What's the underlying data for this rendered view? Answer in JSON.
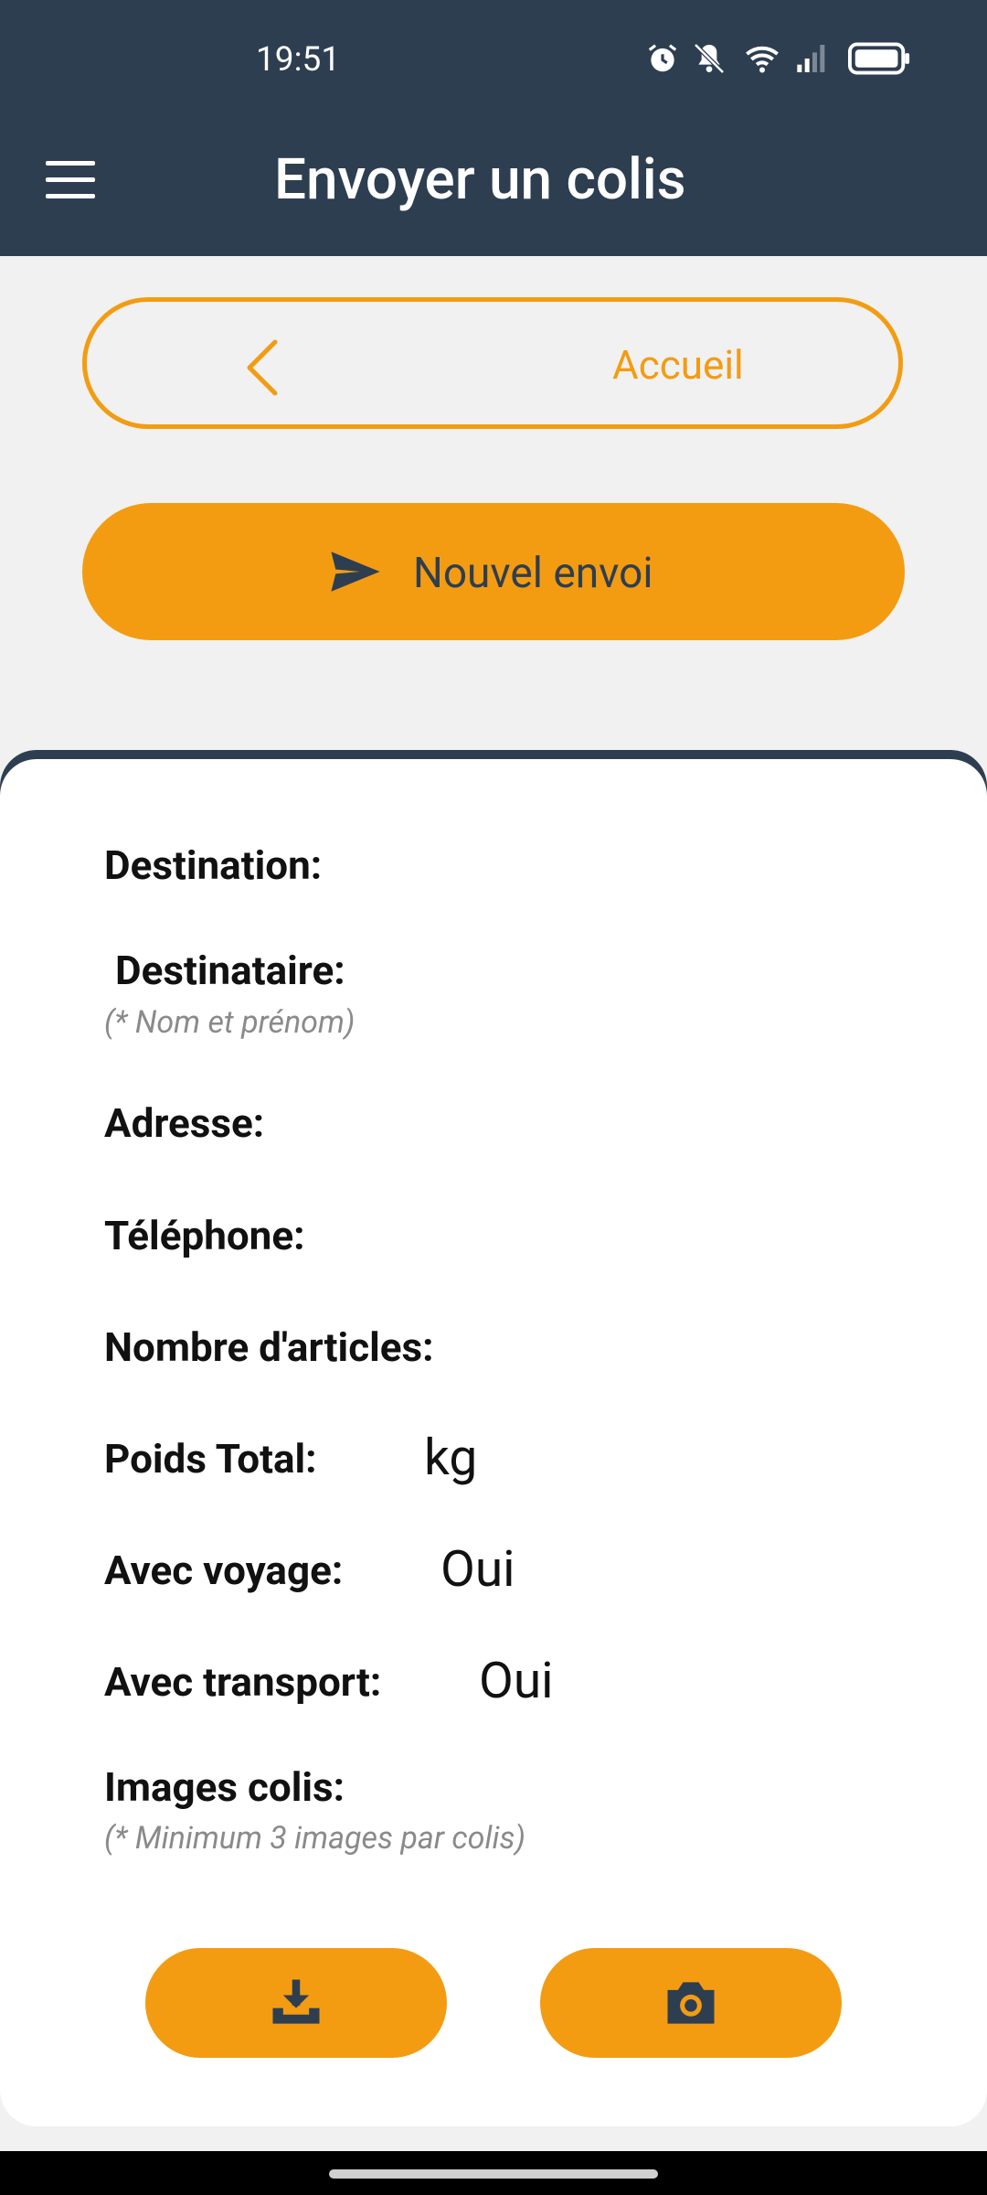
{
  "status_bar": {
    "time": "19:51",
    "icons": [
      "alarm-icon",
      "mute-icon",
      "wifi-icon",
      "signal-icon",
      "battery-icon"
    ]
  },
  "app_bar": {
    "title": "Envoyer un colis",
    "menu_icon": "hamburger-icon"
  },
  "actions": {
    "back_label": "Accueil",
    "back_icon": "chevron-left-icon",
    "new_label": "Nouvel envoi",
    "new_icon": "send-icon"
  },
  "form": {
    "destination_label": "Destination:",
    "destinataire_label": "Destinataire:",
    "destinataire_hint": "(* Nom et prénom)",
    "adresse_label": "Adresse:",
    "telephone_label": "Téléphone:",
    "articles_label": "Nombre d'articles:",
    "poids_label": "Poids Total:",
    "poids_unit": "kg",
    "voyage_label": "Avec voyage:",
    "voyage_value": "Oui",
    "transport_label": "Avec transport:",
    "transport_value": "Oui",
    "images_label": "Images colis:",
    "images_hint": "(* Minimum 3 images par colis)"
  },
  "image_buttons": {
    "upload_icon": "upload-icon",
    "camera_icon": "camera-icon"
  },
  "colors": {
    "primary": "#2e3e51",
    "accent": "#f39c12",
    "background": "#f1f1f1",
    "hint": "#8a8a8a"
  }
}
